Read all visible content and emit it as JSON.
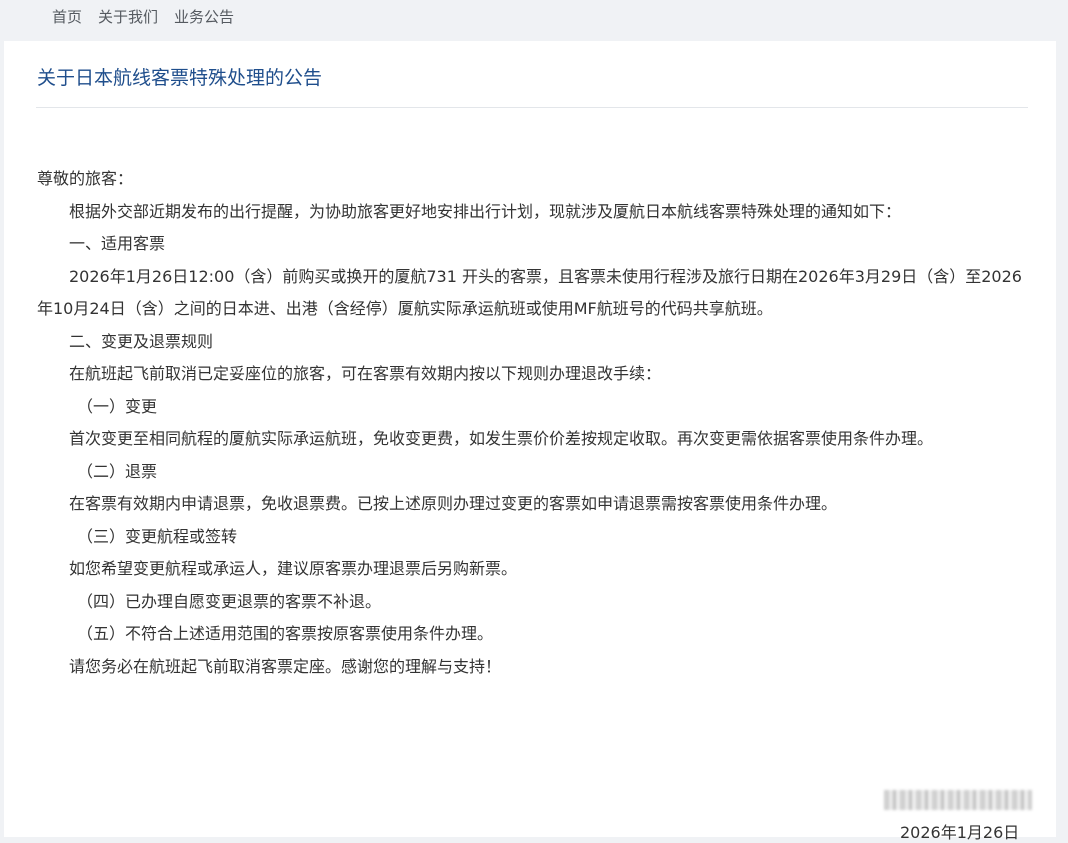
{
  "nav": {
    "items": [
      "首页",
      "关于我们",
      "业务公告"
    ]
  },
  "notice": {
    "title": "关于日本航线客票特殊处理的公告",
    "greeting": "尊敬的旅客：",
    "paragraphs": [
      "根据外交部近期发布的出行提醒，为协助旅客更好地安排出行计划，现就涉及厦航日本航线客票特殊处理的通知如下：",
      "一、适用客票",
      "2026年1月26日12:00（含）前购买或换开的厦航731 开头的客票，且客票未使用行程涉及旅行日期在2026年3月29日（含）至2026年10月24日（含）之间的日本进、出港（含经停）厦航实际承运航班或使用MF航班号的代码共享航班。",
      "二、变更及退票规则",
      "在航班起飞前取消已定妥座位的旅客，可在客票有效期内按以下规则办理退改手续：",
      "（一）变更",
      "首次变更至相同航程的厦航实际承运航班，免收变更费，如发生票价价差按规定收取。再次变更需依据客票使用条件办理。",
      "（二）退票",
      "在客票有效期内申请退票，免收退票费。已按上述原则办理过变更的客票如申请退票需按客票使用条件办理。",
      "（三）变更航程或签转",
      "如您希望变更航程或承运人，建议原客票办理退票后另购新票。",
      "（四）已办理自愿变更退票的客票不补退。",
      "（五）不符合上述适用范围的客票按原客票使用条件办理。",
      "请您务必在航班起飞前取消客票定座。感谢您的理解与支持！"
    ],
    "date": "2026年1月26日"
  },
  "colors": {
    "title": "#1f4e8c",
    "text": "#333333",
    "page_bg": "#f0f2f5",
    "card_bg": "#ffffff"
  }
}
